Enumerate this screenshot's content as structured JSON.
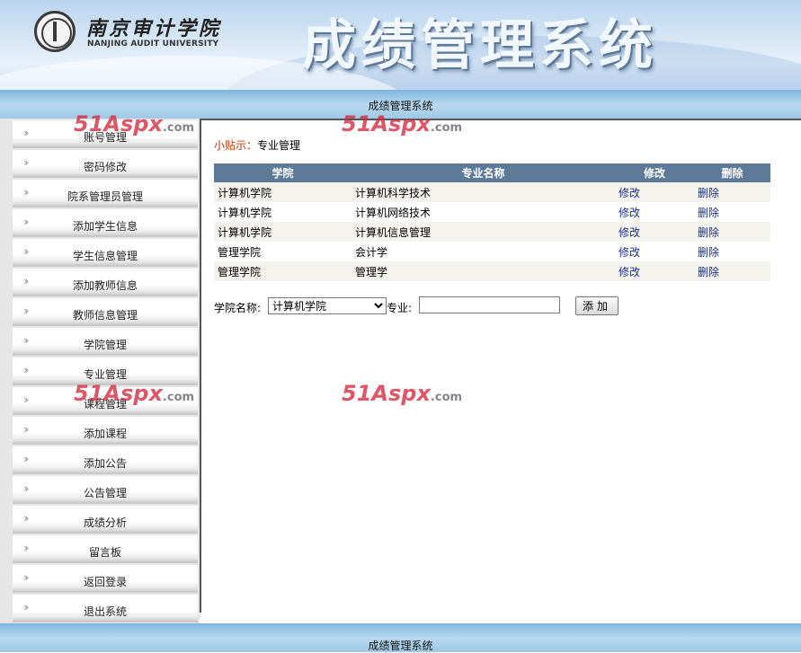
{
  "header": {
    "university_cn": "南京审计学院",
    "university_en": "NANJING AUDIT UNIVERSITY",
    "system_title": "成绩管理系统"
  },
  "nav": {
    "title": "成绩管理系统"
  },
  "sidebar": {
    "items": [
      {
        "label": "账号管理"
      },
      {
        "label": "密码修改"
      },
      {
        "label": "院系管理员管理"
      },
      {
        "label": "添加学生信息"
      },
      {
        "label": "学生信息管理"
      },
      {
        "label": "添加教师信息"
      },
      {
        "label": "教师信息管理"
      },
      {
        "label": "学院管理"
      },
      {
        "label": "专业管理"
      },
      {
        "label": "课程管理"
      },
      {
        "label": "添加课程"
      },
      {
        "label": "添加公告"
      },
      {
        "label": "公告管理"
      },
      {
        "label": "成绩分析"
      },
      {
        "label": "留言板"
      },
      {
        "label": "返回登录"
      },
      {
        "label": "退出系统"
      }
    ]
  },
  "main": {
    "tip_label": "小贴示：",
    "tip_text": "专业管理",
    "table": {
      "headers": [
        "学院",
        "专业名称",
        "修改",
        "删除"
      ],
      "rows": [
        {
          "college": "计算机学院",
          "major": "计算机科学技术",
          "edit": "修改",
          "delete": "删除"
        },
        {
          "college": "计算机学院",
          "major": "计算机网络技术",
          "edit": "修改",
          "delete": "删除"
        },
        {
          "college": "计算机学院",
          "major": "计算机信息管理",
          "edit": "修改",
          "delete": "删除"
        },
        {
          "college": "管理学院",
          "major": "会计学",
          "edit": "修改",
          "delete": "删除"
        },
        {
          "college": "管理学院",
          "major": "管理学",
          "edit": "修改",
          "delete": "删除"
        }
      ]
    },
    "form": {
      "college_label": "学院名称:",
      "college_selected": "计算机学院",
      "major_label": "专业:",
      "major_value": "",
      "add_button": "添加"
    }
  },
  "watermark": {
    "brand": "51Aspx",
    "domain": ".com"
  },
  "footer": {
    "text": "成绩管理系统"
  }
}
